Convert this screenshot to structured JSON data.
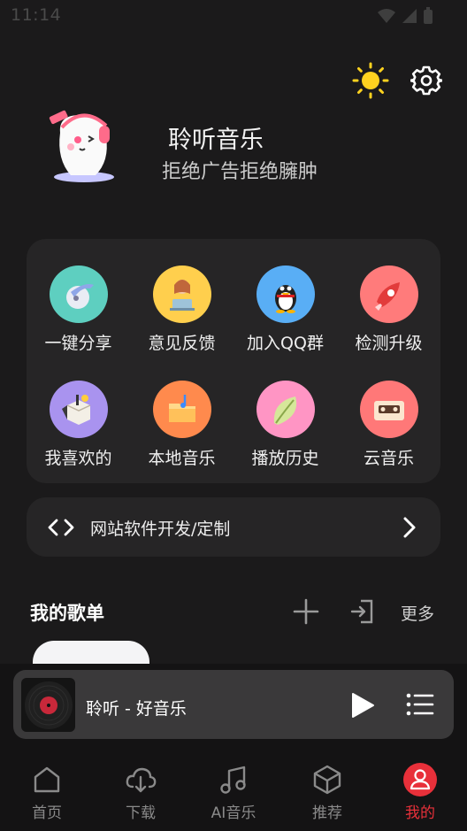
{
  "status_bar": {
    "time": "11:14"
  },
  "header": {
    "icons": [
      "theme-sun-icon",
      "settings-gear-icon"
    ],
    "app_name": "聆听音乐",
    "slogan": "拒绝广告拒绝臃肿"
  },
  "grid": {
    "items": [
      {
        "label": "一键分享",
        "icon": "share-icon",
        "color": "#5ecfc0"
      },
      {
        "label": "意见反馈",
        "icon": "feedback-icon",
        "color": "#ffcf4d"
      },
      {
        "label": "加入QQ群",
        "icon": "qq-penguin-icon",
        "color": "#59aef5"
      },
      {
        "label": "检测升级",
        "icon": "rocket-upgrade-icon",
        "color": "#ff7b7b"
      },
      {
        "label": "我喜欢的",
        "icon": "favorites-box-icon",
        "color": "#a993ef"
      },
      {
        "label": "本地音乐",
        "icon": "local-folder-icon",
        "color": "#ff8a4d"
      },
      {
        "label": "播放历史",
        "icon": "history-leaf-icon",
        "color": "#ff95c4"
      },
      {
        "label": "云音乐",
        "icon": "cassette-icon",
        "color": "#ff7878"
      }
    ]
  },
  "dev_bar": {
    "label": "网站软件开发/定制"
  },
  "playlists": {
    "title": "我的歌单",
    "more": "更多"
  },
  "player": {
    "title": "聆听 - 好音乐"
  },
  "nav": {
    "items": [
      {
        "label": "首页",
        "icon": "home-icon"
      },
      {
        "label": "下载",
        "icon": "cloud-download-icon"
      },
      {
        "label": "AI音乐",
        "icon": "music-note-icon"
      },
      {
        "label": "推荐",
        "icon": "cube-icon"
      },
      {
        "label": "我的",
        "icon": "user-icon"
      }
    ],
    "active_index": 4,
    "active_color": "#e8303a"
  }
}
